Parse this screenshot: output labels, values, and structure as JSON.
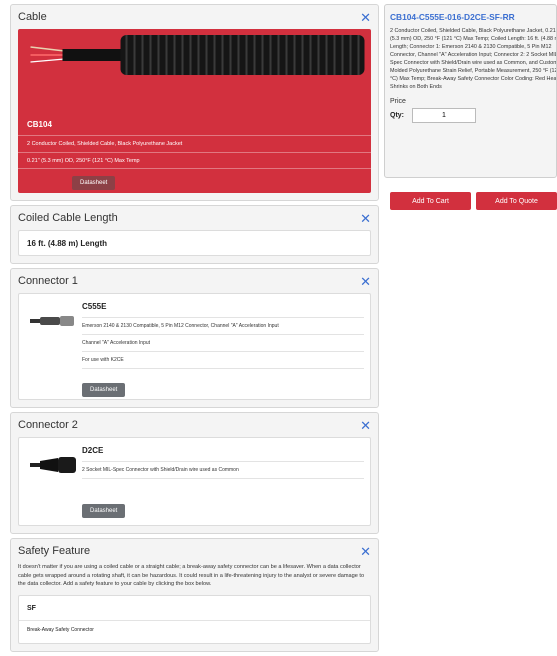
{
  "cable": {
    "header": "Cable",
    "code": "CB104",
    "line1": "2 Conductor Coiled, Shielded Cable, Black Polyurethane Jacket",
    "line2": "0.21\" (5.3 mm) OD, 250°F (121 °C) Max Temp",
    "datasheet": "Datasheet"
  },
  "length": {
    "header": "Coiled Cable Length",
    "value": "16 ft. (4.88 m) Length"
  },
  "connector1": {
    "header": "Connector 1",
    "code": "C555E",
    "rows": [
      "Emerson 2140 & 2130 Compatible, 5 Pin M12 Connector, Channel \"A\" Acceleration Input",
      "Channel \"A\" Acceleration Input",
      "For use with K2CE"
    ],
    "datasheet": "Datasheet"
  },
  "connector2": {
    "header": "Connector 2",
    "code": "D2CE",
    "rows": [
      "2 Socket MIL-Spec Connector with Shield/Drain wire used as Common"
    ],
    "datasheet": "Datasheet"
  },
  "safety": {
    "header": "Safety Feature",
    "text": "It doesn't matter if you are using a coiled cable or a straight cable; a break-away safety connector can be a lifesaver. When a data collector cable gets wrapped around a rotating shaft, it can be hazardous. It could result in a life-threatening injury to the analyst or severe damage to the data collector. Add a safety feature to your cable by clicking the box below.",
    "code": "SF",
    "sub": "Break-Away Safety Connector"
  },
  "summary": {
    "title": "CB104-C555E-016-D2CE-SF-RR",
    "desc": "2 Conductor Coiled, Shielded Cable, Black Polyurethane Jacket, 0.21\" (5.3 mm) OD, 250 °F (121 °C) Max Temp; Coiled Length: 16 ft. (4.88 m) Length; Connector 1: Emerson 2140 & 2130 Compatible, 5 Pin M12 Connector, Channel \"A\" Acceleration Input; Connector 2: 2 Socket MIL-Spec Connector with Shield/Drain wire used as Common, and Custom Molded Polyurethane Strain Relief, Portable Measurement, 250 °F (121 °C) Max Temp; Break-Away Safety Connector Color Coding: Red Heat Shrinks on Both Ends",
    "price_label": "Price",
    "qty_label": "Qty:",
    "qty_value": "1"
  },
  "actions": {
    "cart": "Add To Cart",
    "quote": "Add To Quote"
  },
  "icons": {
    "close": "close-icon"
  },
  "colors": {
    "accent_red": "#d2303e",
    "link_blue": "#3b6fd1"
  }
}
